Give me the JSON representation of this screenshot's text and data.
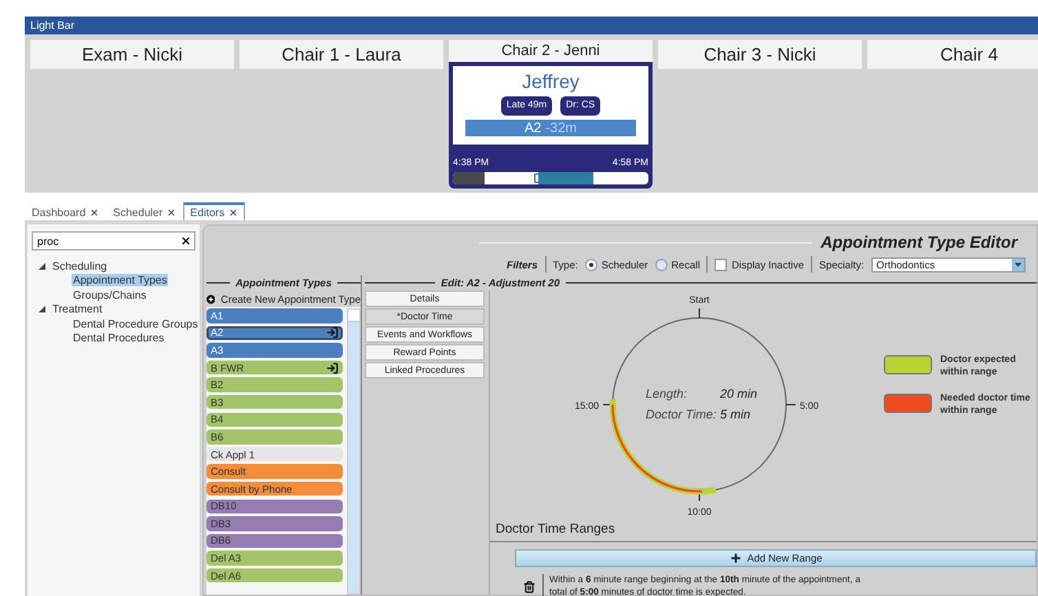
{
  "window": {
    "title": "Light Bar"
  },
  "chairs": [
    {
      "label": "Exam - Nicki",
      "kind": "empty"
    },
    {
      "label": "Chair 1 - Laura",
      "kind": "empty"
    },
    {
      "label": "Chair 2 - Jenni",
      "kind": "occupied",
      "patient": "Jeffrey",
      "badges": [
        "Late 49m",
        "Dr: CS"
      ],
      "procedure": "A2",
      "offset": "-32m",
      "start_time": "4:38 PM",
      "end_time": "4:58 PM"
    },
    {
      "label": "Chair 3 - Nicki",
      "kind": "empty"
    },
    {
      "label": "Chair 4",
      "kind": "empty"
    }
  ],
  "tabs": [
    {
      "label": "Dashboard",
      "selected": false
    },
    {
      "label": "Scheduler",
      "selected": false
    },
    {
      "label": "Editors",
      "selected": true
    }
  ],
  "search": {
    "value": "proc"
  },
  "tree": [
    {
      "label": "Scheduling",
      "expanded": true,
      "selected": false,
      "children": [
        {
          "label": "Appointment Types",
          "selected": true
        },
        {
          "label": "Groups/Chains",
          "selected": false
        }
      ]
    },
    {
      "label": "Treatment",
      "expanded": true,
      "selected": false,
      "children": [
        {
          "label": "Dental Procedure Groups",
          "selected": false
        },
        {
          "label": "Dental Procedures",
          "selected": false
        }
      ]
    }
  ],
  "editor_title": "Appointment Type Editor",
  "filters": {
    "label": "Filters",
    "type_label": "Type:",
    "types": [
      {
        "label": "Scheduler",
        "selected": true
      },
      {
        "label": "Recall",
        "selected": false
      }
    ],
    "display_inactive": {
      "label": "Display Inactive",
      "checked": false
    },
    "specialty_label": "Specialty:",
    "specialty": "Orthodontics"
  },
  "appointment_types": {
    "title": "Appointment Types",
    "create": "Create New Appointment Type",
    "items": [
      {
        "label": "A1",
        "color": "#4a7fc1",
        "selected": false,
        "linked": false
      },
      {
        "label": "A2",
        "color": "#4a7fc1",
        "selected": true,
        "linked": true
      },
      {
        "label": "A3",
        "color": "#4a7fc1",
        "selected": false,
        "linked": false
      },
      {
        "label": "B FWR",
        "color": "#a4c46a",
        "selected": false,
        "linked": true
      },
      {
        "label": "B2",
        "color": "#a4c46a",
        "selected": false,
        "linked": false
      },
      {
        "label": "B3",
        "color": "#a4c46a",
        "selected": false,
        "linked": false
      },
      {
        "label": "B4",
        "color": "#a4c46a",
        "selected": false,
        "linked": false
      },
      {
        "label": "B6",
        "color": "#a4c46a",
        "selected": false,
        "linked": false
      },
      {
        "label": "Ck Appl 1",
        "color": "#e6e6e6",
        "selected": false,
        "linked": false
      },
      {
        "label": "Consult",
        "color": "#f48d3a",
        "selected": false,
        "linked": false
      },
      {
        "label": "Consult by Phone",
        "color": "#f48d3a",
        "selected": false,
        "linked": false
      },
      {
        "label": "DB10",
        "color": "#957db3",
        "selected": false,
        "linked": false
      },
      {
        "label": "DB3",
        "color": "#957db3",
        "selected": false,
        "linked": false
      },
      {
        "label": "DB6",
        "color": "#957db3",
        "selected": false,
        "linked": false
      },
      {
        "label": "Del A3",
        "color": "#a4c46a",
        "selected": false,
        "linked": false
      },
      {
        "label": "Del A6",
        "color": "#a4c46a",
        "selected": false,
        "linked": false
      }
    ]
  },
  "edit": {
    "title": "Edit: A2 - Adjustment 20",
    "tabs": [
      {
        "label": "Details",
        "selected": false
      },
      {
        "label": "*Doctor Time",
        "selected": true
      },
      {
        "label": "Events and Workflows",
        "selected": false
      },
      {
        "label": "Reward Points",
        "selected": false
      },
      {
        "label": "Linked Procedures",
        "selected": false
      }
    ],
    "dial": {
      "top": "Start",
      "right": "5:00",
      "bottom": "10:00",
      "left": "15:00",
      "length_label": "Length:",
      "length": "20 min",
      "doctor_label": "Doctor Time:",
      "doctor_time": "5 min"
    },
    "legend": [
      {
        "label": "Doctor expected within range",
        "color": "#b7d334"
      },
      {
        "label": "Needed doctor time within range",
        "color": "#f04a23"
      }
    ],
    "ranges_title": "Doctor Time Ranges",
    "add_button": "Add New Range",
    "ranges": [
      "Within a **6** minute range beginning at the **10th** minute of the appointment, a total of **5:00** minutes of doctor time is expected."
    ]
  }
}
